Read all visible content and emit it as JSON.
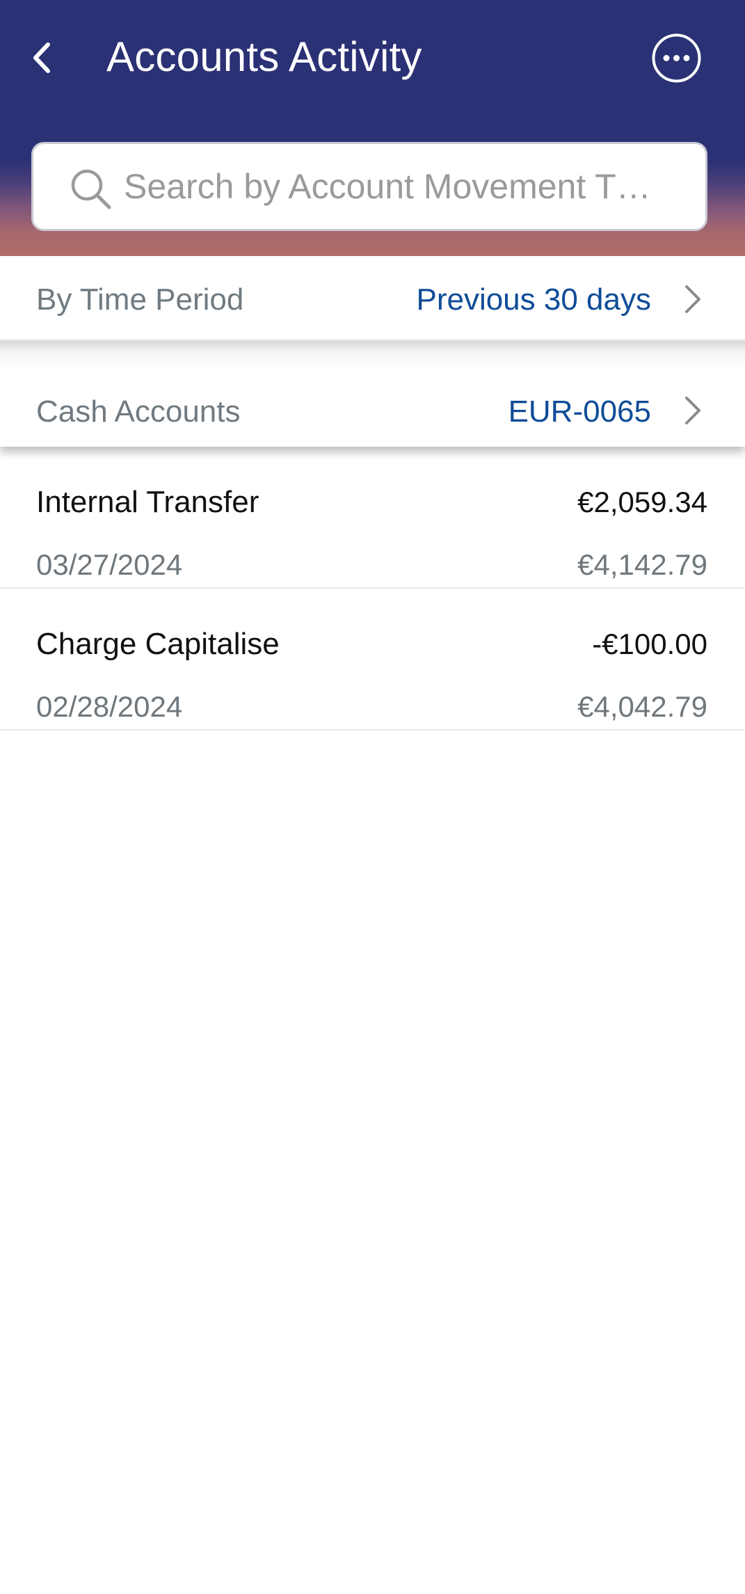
{
  "header": {
    "title": "Accounts Activity",
    "back_icon": "chevron-left-icon",
    "more_icon": "more-options-icon",
    "background_color": "#2a3175",
    "gradient_end_color": "#b06e6a"
  },
  "search": {
    "placeholder": "Search by Account Movement T…",
    "value": "",
    "icon": "search-icon"
  },
  "filters": {
    "time_period": {
      "label": "By Time Period",
      "value": "Previous 30 days"
    },
    "accounts": {
      "label": "Cash Accounts",
      "value": "EUR-0065"
    },
    "value_color": "#0f4c97"
  },
  "transactions": [
    {
      "name": "Internal Transfer",
      "amount": "€2,059.34",
      "date": "03/27/2024",
      "balance": "€4,142.79"
    },
    {
      "name": "Charge Capitalise",
      "amount": "-€100.00",
      "date": "02/28/2024",
      "balance": "€4,042.79"
    }
  ]
}
